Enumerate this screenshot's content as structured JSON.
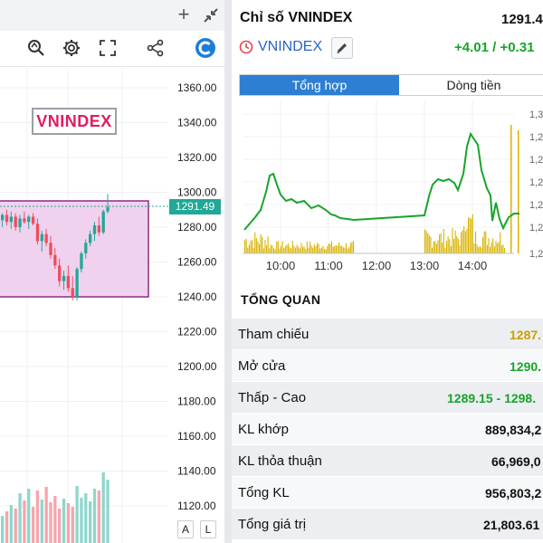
{
  "chart_panel": {
    "brand_label": "VNINDEX",
    "current_price_tag": "1291.49",
    "price_axis": [
      "1360.00",
      "1340.00",
      "1320.00",
      "1300.00",
      "1280.00",
      "1260.00",
      "1240.00",
      "1220.00",
      "1200.00",
      "1180.00",
      "1160.00",
      "1140.00",
      "1120.00"
    ],
    "scale_buttons": [
      "A",
      "L"
    ],
    "colors": {
      "up": "#21a896",
      "down": "#ef4d5c",
      "zone": "#f0d2ef",
      "zone_border": "#8a2c8c"
    },
    "icons": [
      "plus-icon",
      "collapse-icon",
      "magnify-icon",
      "gear-icon",
      "fullscreen-icon",
      "share-icon",
      "brand-logo-icon"
    ]
  },
  "detail_panel": {
    "title": "Chỉ số VNINDEX",
    "price": "1291.4",
    "symbol": "VNINDEX",
    "change": "+4.01 / +0.31",
    "tabs": [
      {
        "label": "Tổng hợp",
        "active": true
      },
      {
        "label": "Dòng tiền",
        "active": false
      }
    ],
    "section_title": "TỔNG QUAN",
    "stats": [
      {
        "label": "Tham chiếu",
        "value": "1287.",
        "color": "#c8a000"
      },
      {
        "label": "Mở cửa",
        "value": "1290.",
        "color": "#17a52a"
      },
      {
        "label": "Thấp - Cao",
        "value_low": "1289.15",
        "sep": " - ",
        "value_high": "1298.",
        "color": "#17a52a"
      },
      {
        "label": "KL khớp",
        "value": "889,834,2",
        "color": "#111"
      },
      {
        "label": "KL thỏa thuận",
        "value": "66,969,0",
        "color": "#111"
      },
      {
        "label": "Tổng KL",
        "value": "956,803,2",
        "color": "#111"
      },
      {
        "label": "Tổng giá trị",
        "value": "21,803.61",
        "color": "#111"
      }
    ]
  },
  "chart_data": {
    "type": "line",
    "x_ticks": [
      "10:00",
      "11:00",
      "12:00",
      "13:00",
      "14:00"
    ],
    "y_ticks": [
      "1,3",
      "1,2",
      "1,2",
      "1,2",
      "1,2",
      "1,2",
      "1,2"
    ],
    "line_color": "#17a52a",
    "volume_color": "#d9b400"
  }
}
